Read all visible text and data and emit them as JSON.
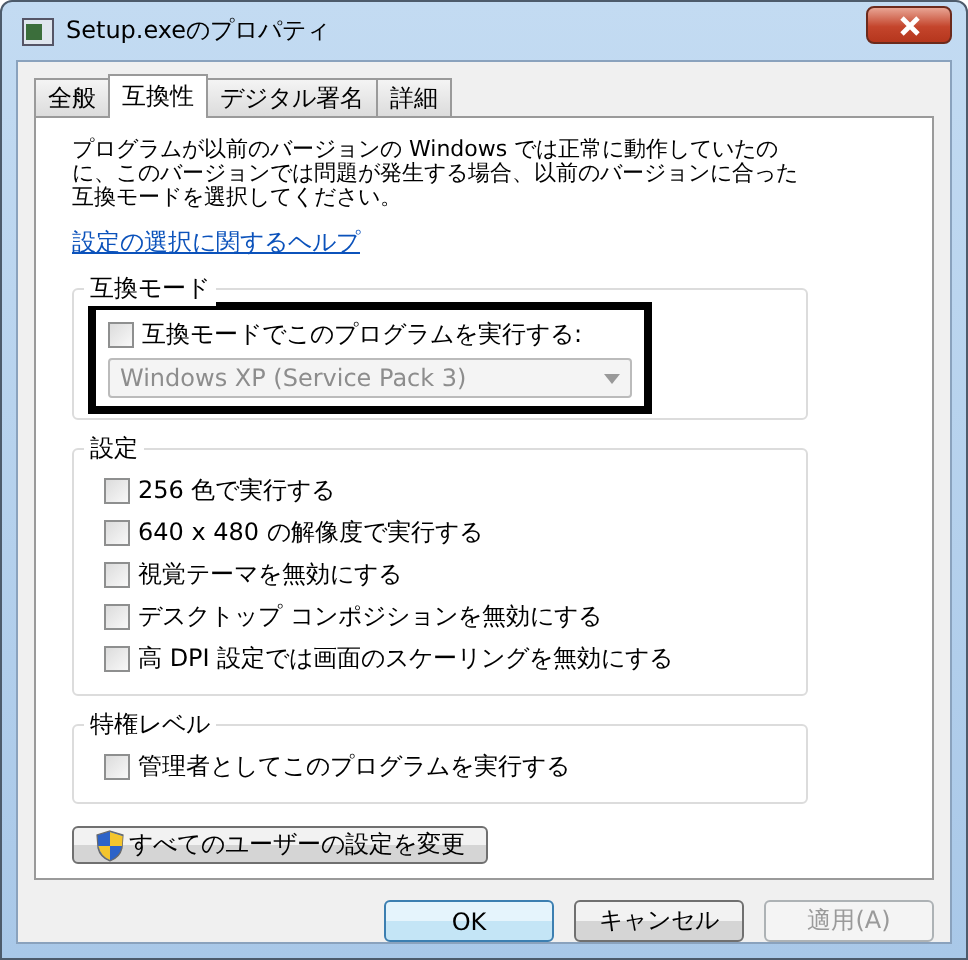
{
  "window": {
    "title": "Setup.exeのプロパティ"
  },
  "tabs": [
    {
      "label": "全般",
      "selected": false
    },
    {
      "label": "互換性",
      "selected": true
    },
    {
      "label": "デジタル署名",
      "selected": false
    },
    {
      "label": "詳細",
      "selected": false
    }
  ],
  "description": "プログラムが以前のバージョンの Windows では正常に動作していたのに、このバージョンでは問題が発生する場合、以前のバージョンに合った互換モードを選択してください。",
  "help_link": "設定の選択に関するヘルプ",
  "groups": [
    {
      "title": "互換モード",
      "highlighted": true,
      "items": [
        {
          "kind": "checkbox",
          "label": "互換モードでこのプログラムを実行する:",
          "checked": false
        },
        {
          "kind": "dropdown",
          "value": "Windows XP (Service Pack 3)",
          "disabled": true
        }
      ]
    },
    {
      "title": "設定",
      "highlighted": false,
      "items": [
        {
          "kind": "checkbox",
          "label": "256 色で実行する",
          "checked": false
        },
        {
          "kind": "checkbox",
          "label": "640 x 480 の解像度で実行する",
          "checked": false
        },
        {
          "kind": "checkbox",
          "label": "視覚テーマを無効にする",
          "checked": false
        },
        {
          "kind": "checkbox",
          "label": "デスクトップ コンポジションを無効にする",
          "checked": false
        },
        {
          "kind": "checkbox",
          "label": "高 DPI 設定では画面のスケーリングを無効にする",
          "checked": false
        }
      ]
    },
    {
      "title": "特権レベル",
      "highlighted": false,
      "items": [
        {
          "kind": "checkbox",
          "label": "管理者としてこのプログラムを実行する",
          "checked": false
        }
      ]
    }
  ],
  "all_users_button": "すべてのユーザーの設定を変更",
  "buttons": [
    {
      "label": "OK",
      "default": true,
      "disabled": false
    },
    {
      "label": "キャンセル",
      "default": false,
      "disabled": false
    },
    {
      "label": "適用(A)",
      "default": false,
      "disabled": true
    }
  ]
}
